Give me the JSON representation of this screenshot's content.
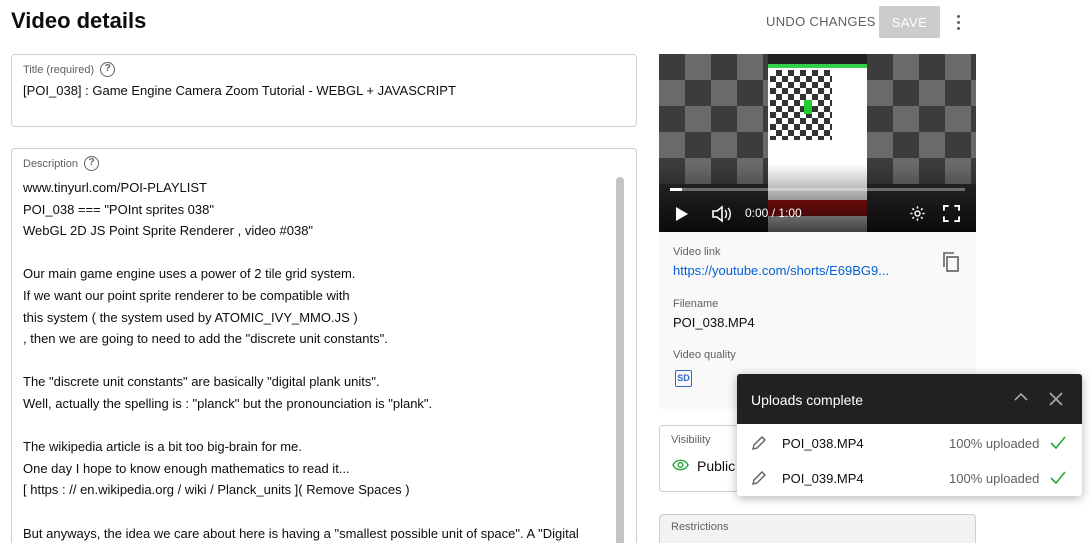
{
  "header": {
    "title": "Video details",
    "undo_label": "UNDO CHANGES",
    "save_label": "SAVE"
  },
  "title_field": {
    "label": "Title (required)",
    "value": "[POI_038] : Game Engine Camera Zoom Tutorial - WEBGL + JAVASCRIPT"
  },
  "description_field": {
    "label": "Description",
    "lines": [
      "www.tinyurl.com/POI-PLAYLIST",
      "POI_038 === \"POInt sprites 038\"",
      "WebGL 2D JS Point Sprite Renderer , video #038\"",
      "",
      "Our main game engine uses a power of 2 tile grid system.",
      "If we want our point sprite renderer to be compatible with",
      "this system ( the system used by ATOMIC_IVY_MMO.JS )",
      ", then we are going to need to add the \"discrete unit constants\".",
      "",
      "The \"discrete unit constants\" are basically \"digital plank units\".",
      "Well, actually the spelling is : \"planck\" but the pronounciation is \"plank\".",
      "",
      "The wikipedia article is a bit too big-brain for me.",
      "One day I hope to know enough mathematics to read it...",
      "[ https : // en.wikipedia.org / wiki / Planck_units ]( Remove Spaces )",
      "",
      "But anyways, the idea we care about here is having a \"smallest possible unit of space\". A \"Digital"
    ]
  },
  "player": {
    "time": "0:00 / 1:00",
    "progress": 0.04
  },
  "info": {
    "video_link_label": "Video link",
    "video_link": "https://youtube.com/shorts/E69BG9...",
    "filename_label": "Filename",
    "filename": "POI_038.MP4",
    "quality_label": "Video quality",
    "quality_badge": "SD"
  },
  "visibility": {
    "label": "Visibility",
    "value": "Public"
  },
  "restrictions": {
    "label": "Restrictions"
  },
  "uploads": {
    "title": "Uploads complete",
    "items": [
      {
        "file": "POI_038.MP4",
        "status": "100% uploaded"
      },
      {
        "file": "POI_039.MP4",
        "status": "100% uploaded"
      }
    ]
  },
  "colors": {
    "link": "#065fd4",
    "success": "#2ba640",
    "popup_header": "#212121"
  }
}
